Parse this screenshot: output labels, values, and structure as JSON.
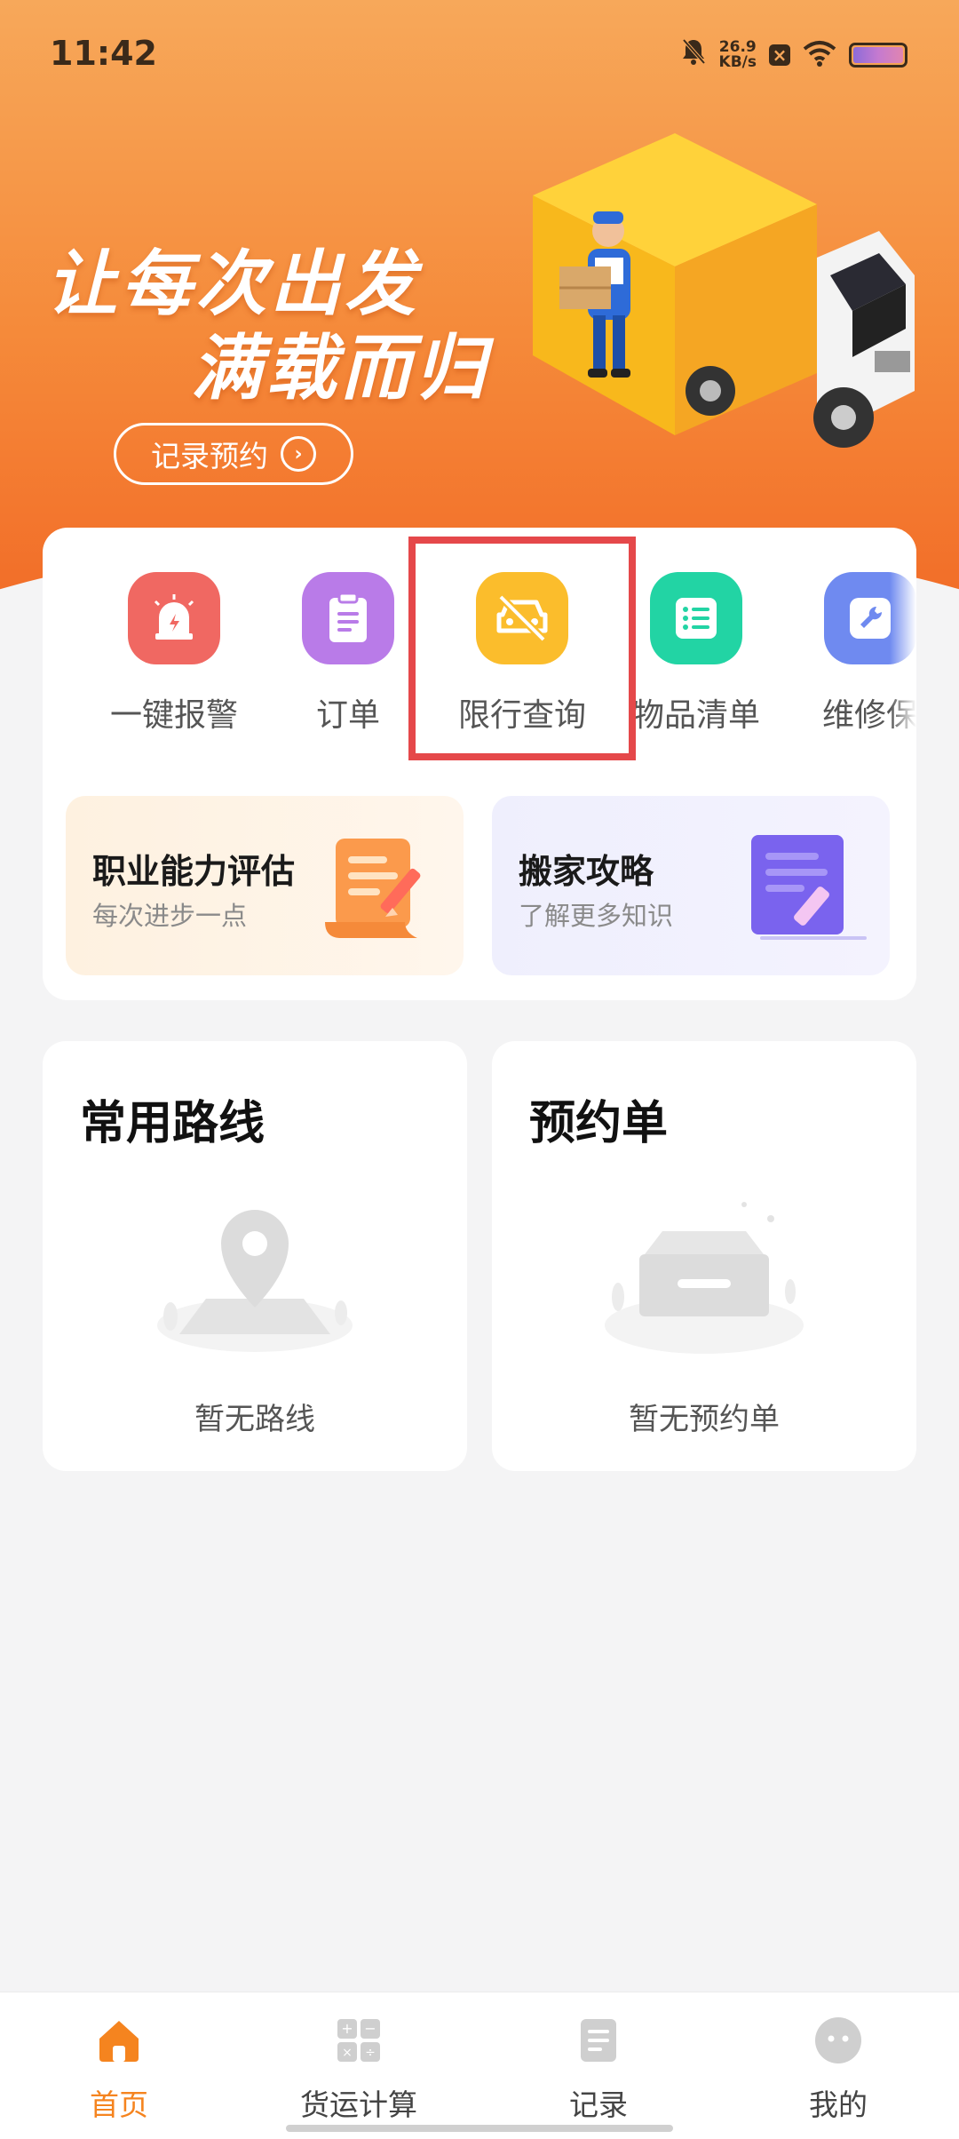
{
  "status_bar": {
    "time": "11:42",
    "net_speed_value": "26.9",
    "net_speed_unit": "KB/s",
    "icons": [
      "bell-off-icon",
      "x-box-icon",
      "wifi-icon",
      "battery-icon"
    ]
  },
  "banner": {
    "slogan_line1": "让每次出发",
    "slogan_line2": "满载而归",
    "record_button": "记录预约",
    "colors": {
      "gradient_top": "#f7a85a",
      "gradient_bottom": "#f26d28"
    }
  },
  "menu": {
    "items": [
      {
        "label": "一键报警",
        "icon": "alarm-icon",
        "color": "#f06862"
      },
      {
        "label": "订单",
        "icon": "clipboard-icon",
        "color": "#b97be8"
      },
      {
        "label": "限行查询",
        "icon": "no-car-icon",
        "color": "#fbbd2c"
      },
      {
        "label": "物品清单",
        "icon": "list-icon",
        "color": "#22d4a4"
      },
      {
        "label": "维修保",
        "icon": "wrench-icon",
        "color": "#6f8af0"
      }
    ],
    "highlighted_item": "限行查询"
  },
  "promos": [
    {
      "title": "职业能力评估",
      "subtitle": "每次进步一点",
      "icon": "scroll-pen-icon"
    },
    {
      "title": "搬家攻略",
      "subtitle": "了解更多知识",
      "icon": "document-pen-icon"
    }
  ],
  "cards": {
    "routes": {
      "title": "常用路线",
      "empty_text": "暂无路线",
      "icon": "map-pin-icon"
    },
    "bookings": {
      "title": "预约单",
      "empty_text": "暂无预约单",
      "icon": "empty-tray-icon"
    }
  },
  "bottom_nav": {
    "items": [
      {
        "label": "首页",
        "icon": "home-icon",
        "active": true
      },
      {
        "label": "货运计算",
        "icon": "calculator-icon",
        "active": false
      },
      {
        "label": "记录",
        "icon": "record-icon",
        "active": false
      },
      {
        "label": "我的",
        "icon": "profile-icon",
        "active": false
      }
    ],
    "active_color": "#f5841f"
  }
}
